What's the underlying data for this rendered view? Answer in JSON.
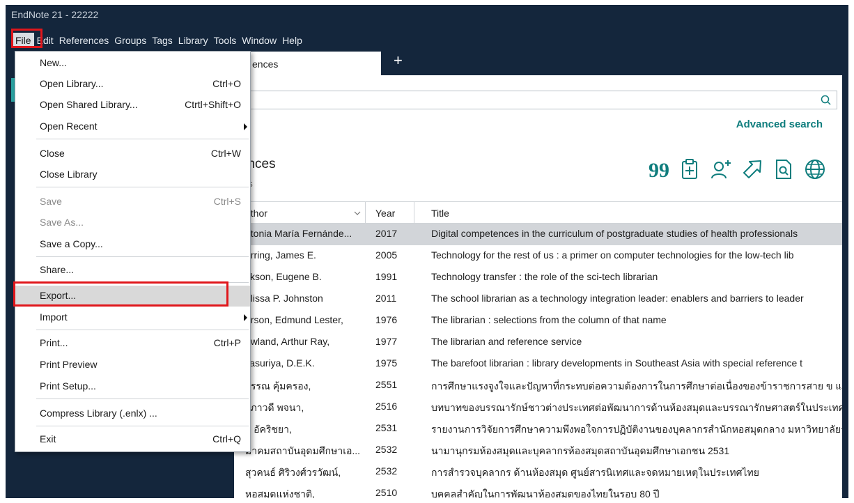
{
  "window": {
    "title": "EndNote 21 - 22222"
  },
  "menubar": [
    "File",
    "Edit",
    "References",
    "Groups",
    "Tags",
    "Library",
    "Tools",
    "Window",
    "Help"
  ],
  "tab": {
    "label": "ences",
    "add": "+"
  },
  "search": {
    "advanced": "Advanced search",
    "icon": "search-icon"
  },
  "library": {
    "title": "erences",
    "subtitle": "ences"
  },
  "toolbar_icons": [
    "quote-icon",
    "clipboard-add-icon",
    "add-user-icon",
    "share-arrow-icon",
    "find-in-pdf-icon",
    "globe-icon"
  ],
  "table": {
    "headers": {
      "author": "uthor",
      "year": "Year",
      "title": "Title"
    },
    "rows": [
      {
        "author": "ntonia María Fernánde...",
        "year": "2017",
        "title": "Digital competences in the curriculum of postgraduate studies of health professionals"
      },
      {
        "author": "erring, James E.",
        "year": "2005",
        "title": "Technology for the rest of us : a primer on computer technologies for the low-tech lib"
      },
      {
        "author": "ckson, Eugene B.",
        "year": "1991",
        "title": "Technology transfer : the role of the sci-tech librarian"
      },
      {
        "author": "elissa P. Johnston",
        "year": "2011",
        "title": "The school librarian as a technology integration leader: enablers and barriers to leader"
      },
      {
        "author": "arson, Edmund Lester,",
        "year": "1976",
        "title": "The librarian : selections from the column of that name"
      },
      {
        "author": "owland, Arthur Ray,",
        "year": "1977",
        "title": "The librarian and reference service"
      },
      {
        "author": "ijasuriya, D.E.K.",
        "year": "1975",
        "title": "The barefoot librarian : library developments in Southeast Asia with special reference t"
      },
      {
        "author": "วรรณ คุ้มครอง,",
        "year": "2551",
        "title": "การศึกษาแรงจูงใจและปัญหาที่กระทบต่อความต้องการในการศึกษาต่อเนื่องของข้าราชการสาย ข และสา"
      },
      {
        "author": "ะภาวดี พจนา,",
        "year": "2516",
        "title": "บทบาทของบรรณารักษ์ชาวต่างประเทศต่อพัฒนาการด้านห้องสมุดและบรรณารักษศาสตร์ในประเทศไทย"
      },
      {
        "author": "ย อัคริชยา,",
        "year": "2531",
        "title": "รายงานการวิจัยการศึกษาความพึงพอใจการปฏิบัติงานของบุคลากรสำนักหอสมุดกลาง มหาวิทยาลัยรา"
      },
      {
        "author": "มาคมสถาบันอุดมศึกษาเอ...",
        "year": "2532",
        "title": "นามานุกรมห้องสมุดและบุคลากรห้องสมุดสถาบันอุดมศึกษาเอกชน 2531"
      },
      {
        "author": "สุวคนธ์ ศิริวงศ์วรวัฒน์,",
        "year": "2532",
        "title": "การสำรวจบุคลากร ด้านห้องสมุด ศูนย์สารนิเทศและจดหมายเหตุในประเทศไทย"
      },
      {
        "author": "หอสมุดแห่งชาติ,",
        "year": "2510",
        "title": "บุคคลสำคัญในการพัฒนาห้องสมุดของไทยในรอบ 80 ปี"
      }
    ]
  },
  "file_menu": {
    "items": [
      {
        "label": "New...",
        "shortcut": ""
      },
      {
        "label": "Open Library...",
        "shortcut": "Ctrl+O"
      },
      {
        "label": "Open Shared Library...",
        "shortcut": "Ctrtl+Shift+O"
      },
      {
        "label": "Open Recent",
        "shortcut": ""
      },
      {
        "label": "Close",
        "shortcut": "Ctrl+W"
      },
      {
        "label": "Close Library",
        "shortcut": ""
      },
      {
        "label": "Save",
        "shortcut": "Ctrl+S"
      },
      {
        "label": "Save As...",
        "shortcut": ""
      },
      {
        "label": "Save a Copy...",
        "shortcut": ""
      },
      {
        "label": "Share...",
        "shortcut": ""
      },
      {
        "label": "Export...",
        "shortcut": ""
      },
      {
        "label": "Import",
        "shortcut": ""
      },
      {
        "label": "Print...",
        "shortcut": "Ctrl+P"
      },
      {
        "label": "Print Preview",
        "shortcut": ""
      },
      {
        "label": "Print Setup...",
        "shortcut": ""
      },
      {
        "label": "Compress Library (.enlx) ...",
        "shortcut": ""
      },
      {
        "label": "Exit",
        "shortcut": "Ctrl+Q"
      }
    ]
  },
  "colors": {
    "frame": "#14263c",
    "accent": "#0f7d7d",
    "highlight": "#e0161b",
    "selection": "#d2d5d9"
  }
}
